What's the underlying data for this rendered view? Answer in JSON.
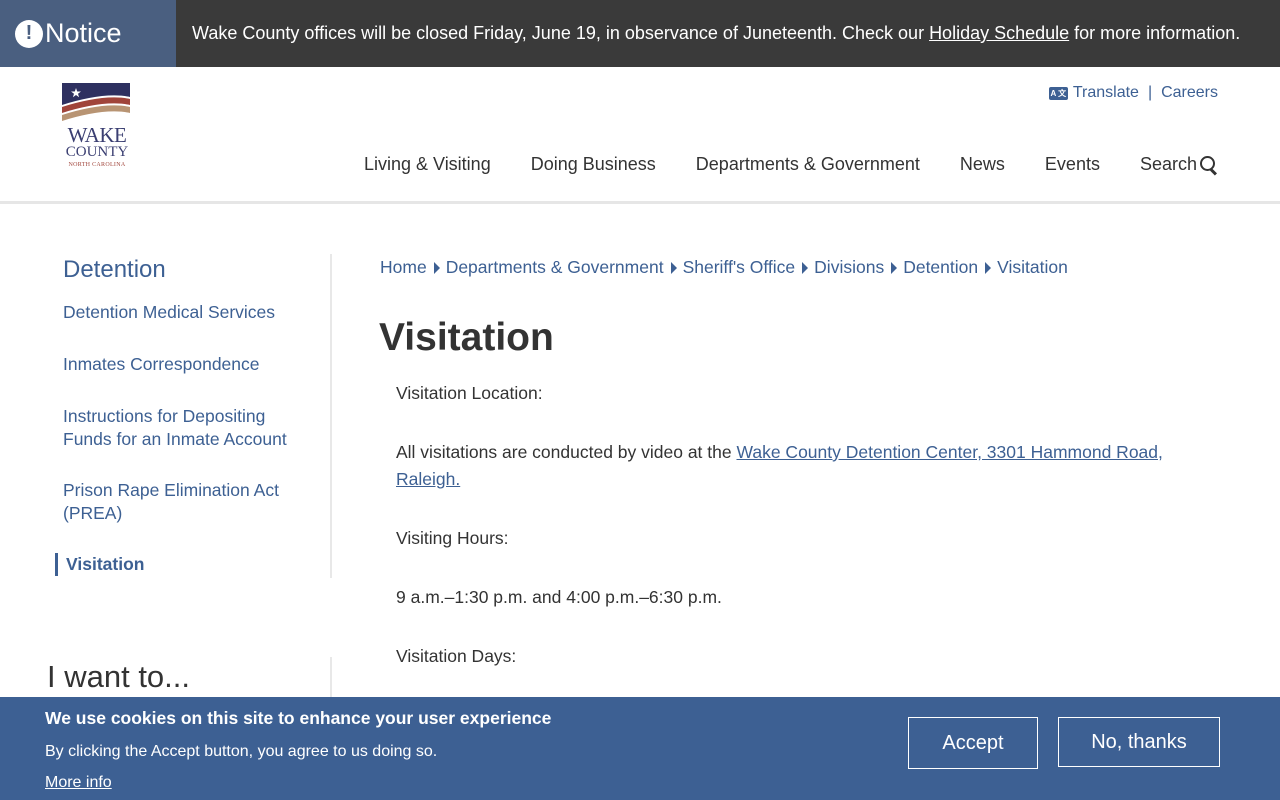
{
  "notice": {
    "label": "Notice",
    "text_before": "Wake County offices will be closed Friday, June 19, in observance of Juneteenth. Check our ",
    "link": "Holiday Schedule",
    "text_after": " for more information."
  },
  "logo": {
    "line1": "WAKE",
    "line2": "COUNTY",
    "line3": "NORTH CAROLINA",
    "colors": {
      "navy": "#2e3060",
      "rust": "#a0443a",
      "tan": "#b89473"
    }
  },
  "utility_nav": {
    "translate_icon": "translate-icon",
    "translate_icon_text": "A 文",
    "translate": "Translate",
    "separator": "|",
    "careers": "Careers"
  },
  "main_nav": {
    "items": [
      "Living & Visiting",
      "Doing Business",
      "Departments & Government",
      "News",
      "Events"
    ],
    "search": "Search",
    "search_icon": "search-icon"
  },
  "sidebar": {
    "title": "Detention",
    "items": [
      {
        "label": "Detention Medical Services"
      },
      {
        "label": "Inmates Correspondence"
      },
      {
        "label": "Instructions for Depositing Funds for an Inmate Account"
      },
      {
        "label": "Prison Rape Elimination Act (PREA)"
      },
      {
        "label": "Visitation",
        "active": true
      }
    ],
    "i_want_to": "I want to..."
  },
  "breadcrumb": [
    "Home",
    "Departments & Government",
    "Sheriff's Office",
    "Divisions",
    "Detention",
    "Visitation"
  ],
  "page": {
    "title": "Visitation",
    "location_heading": "Visitation Location:",
    "location_text": "All visitations are conducted by video at the ",
    "location_link": "Wake County Detention Center, 3301 Hammond Road, Raleigh.",
    "hours_heading": "Visiting Hours:",
    "hours_text": "9 a.m.–1:30 p.m. and 4:00 p.m.–6:30 p.m.",
    "days_heading": "Visitation Days:"
  },
  "cookie": {
    "title": "We use cookies on this site to enhance your user experience",
    "description": "By clicking the Accept button, you agree to us doing so.",
    "more_info": "More info",
    "accept": "Accept",
    "decline": "No, thanks"
  },
  "colors": {
    "notice_bg": "#3a3a3a",
    "notice_label_bg": "#4a5f80",
    "link_blue": "#3d6093",
    "cookie_bg": "#3d6093"
  }
}
